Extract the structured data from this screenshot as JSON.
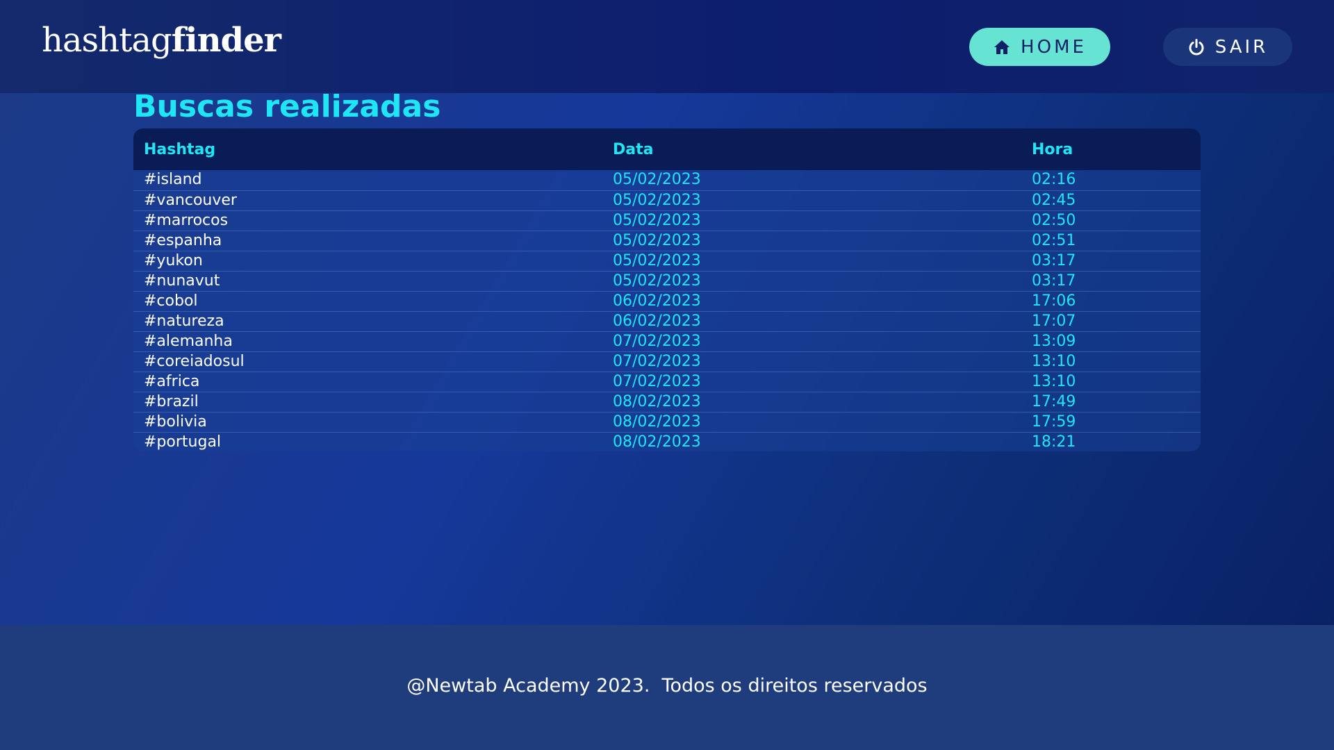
{
  "header": {
    "logo_light": "hashtag",
    "logo_bold": "finder",
    "home_label": "HOME",
    "home_icon": "home-icon",
    "logout_label": "SAIR",
    "logout_icon": "power-icon"
  },
  "main": {
    "title": "Buscas realizadas",
    "columns": [
      "Hashtag",
      "Data",
      "Hora"
    ],
    "rows": [
      {
        "hashtag": "#island",
        "data": "05/02/2023",
        "hora": "02:16"
      },
      {
        "hashtag": "#vancouver",
        "data": "05/02/2023",
        "hora": "02:45"
      },
      {
        "hashtag": "#marrocos",
        "data": "05/02/2023",
        "hora": "02:50"
      },
      {
        "hashtag": "#espanha",
        "data": "05/02/2023",
        "hora": "02:51"
      },
      {
        "hashtag": "#yukon",
        "data": "05/02/2023",
        "hora": "03:17"
      },
      {
        "hashtag": "#nunavut",
        "data": "05/02/2023",
        "hora": "03:17"
      },
      {
        "hashtag": "#cobol",
        "data": "06/02/2023",
        "hora": "17:06"
      },
      {
        "hashtag": "#natureza",
        "data": "06/02/2023",
        "hora": "17:07"
      },
      {
        "hashtag": "#alemanha",
        "data": "07/02/2023",
        "hora": "13:09"
      },
      {
        "hashtag": "#coreiadosul",
        "data": "07/02/2023",
        "hora": "13:10"
      },
      {
        "hashtag": "#africa",
        "data": "07/02/2023",
        "hora": "13:10"
      },
      {
        "hashtag": "#brazil",
        "data": "08/02/2023",
        "hora": "17:49"
      },
      {
        "hashtag": "#bolivia",
        "data": "08/02/2023",
        "hora": "17:59"
      },
      {
        "hashtag": "#portugal",
        "data": "08/02/2023",
        "hora": "18:21"
      }
    ]
  },
  "footer": {
    "text": "@Newtab Academy 2023.  Todos os direitos reservados"
  },
  "colors": {
    "accent": "#1fe6f4",
    "home_button": "#67e3d3",
    "logout_button": "#1a357a",
    "header_bg": "#0c1d6e",
    "table_header_bg": "#0a1c55",
    "footer_bg": "#1f3c7c"
  }
}
